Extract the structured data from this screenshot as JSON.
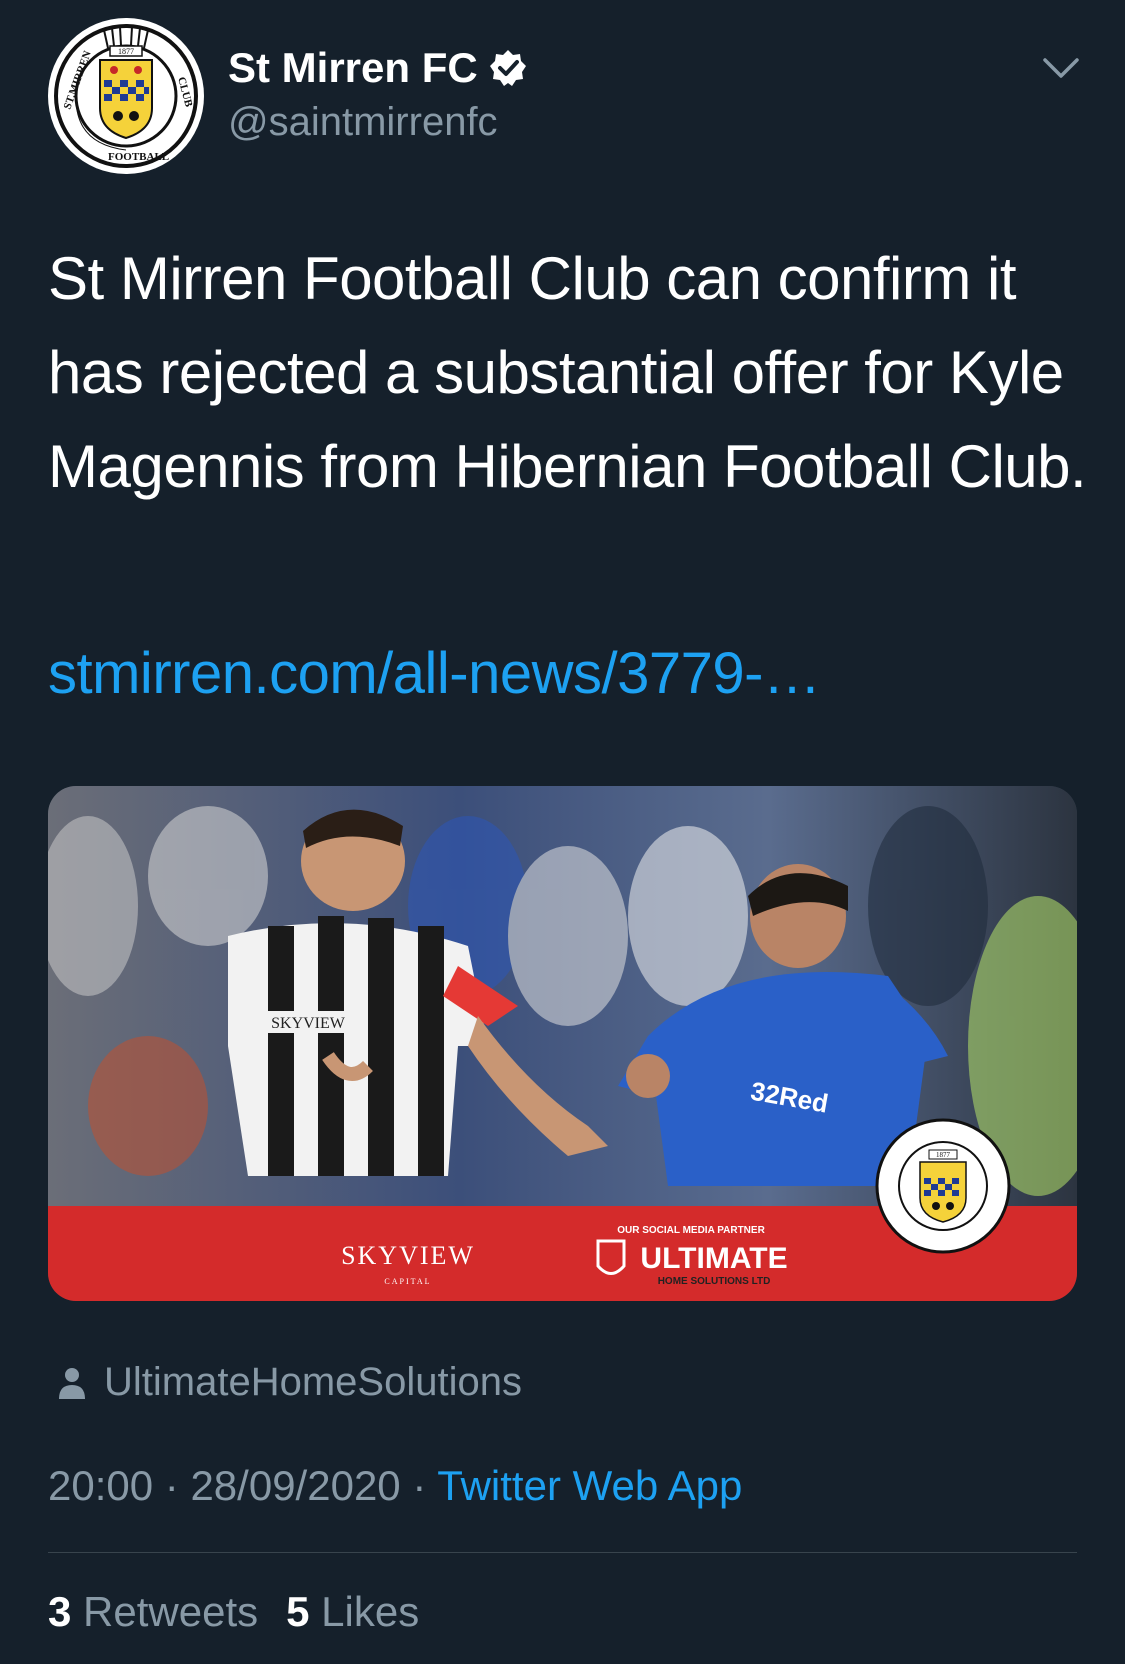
{
  "header": {
    "display_name": "St Mirren FC",
    "handle": "@saintmirrenfc",
    "avatar_icon": "st-mirren-crest-icon",
    "avatar_text": "ST. MIRREN FOOTBALL CLUB",
    "avatar_year": "1877",
    "verified_icon": "verified-badge-icon",
    "menu_icon": "chevron-down-icon"
  },
  "tweet": {
    "text": "St Mirren Football Club can confirm it has rejected a substantial offer for Kyle Magennis from Hibernian Football Club.",
    "link": "stmirren.com/all-news/3779-…"
  },
  "media": {
    "description_icon": "match-photo",
    "shirt_sponsor_left": "SKYVIEW",
    "shirt_sponsor_right": "32Red",
    "banner_left_brand": "SKYVIEW",
    "banner_left_sub": "CAPITAL",
    "banner_partner_caption": "OUR SOCIAL MEDIA PARTNER",
    "banner_partner_name": "ULTIMATE",
    "banner_partner_sub": "HOME SOLUTIONS LTD",
    "banner_crest_year": "1877",
    "banner_color": "#d42b2b"
  },
  "tagged": {
    "icon": "person-icon",
    "user": "UltimateHomeSolutions"
  },
  "meta": {
    "time": "20:00",
    "date": "28/09/2020",
    "separator": "·",
    "source": "Twitter Web App"
  },
  "stats": {
    "retweets_count": "3",
    "retweets_label": "Retweets",
    "likes_count": "5",
    "likes_label": "Likes"
  },
  "colors": {
    "background": "#15202b",
    "accent": "#1da1f2",
    "secondary_text": "#8899a6"
  }
}
